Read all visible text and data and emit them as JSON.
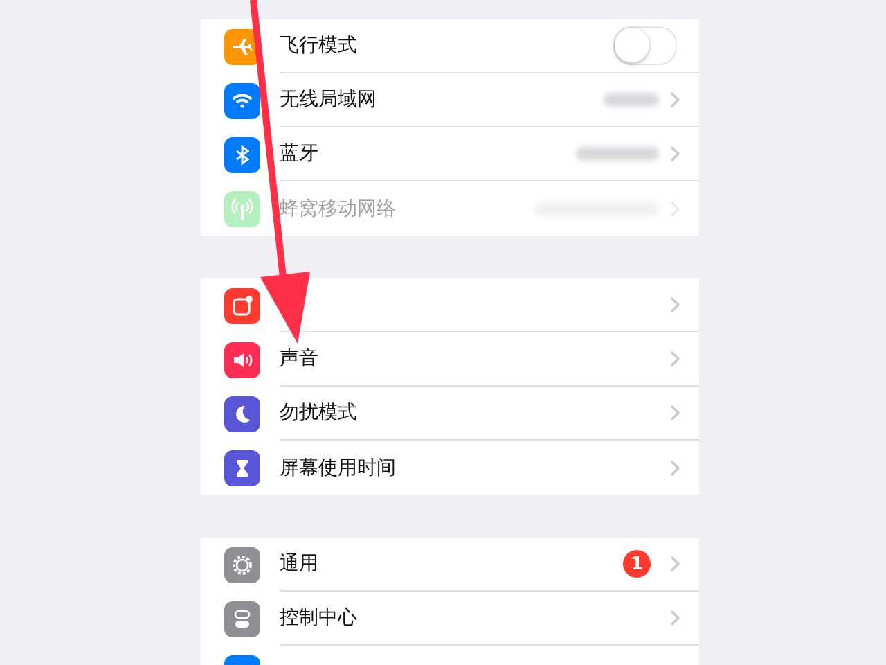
{
  "groups": [
    {
      "items": [
        {
          "kind": "toggle",
          "label": "飞行模式",
          "on": false,
          "disabled": false
        },
        {
          "kind": "hidden-value",
          "label": "无线局域网",
          "disabled": false
        },
        {
          "kind": "hidden-value",
          "label": "蓝牙",
          "disabled": false
        },
        {
          "kind": "hidden-value",
          "label": "蜂窝移动网络",
          "disabled": true
        }
      ]
    },
    {
      "items": [
        {
          "kind": "link",
          "disabled": false
        },
        {
          "kind": "link",
          "label": "声音",
          "disabled": false
        },
        {
          "kind": "link",
          "label": "勿扰模式",
          "disabled": false
        },
        {
          "kind": "link",
          "label": "屏幕使用时间",
          "disabled": false
        }
      ]
    },
    {
      "items": [
        {
          "kind": "badge",
          "label": "通用",
          "badge": "1",
          "disabled": false
        },
        {
          "kind": "link",
          "label": "控制中心",
          "disabled": false
        },
        {
          "kind": "cut",
          "disabled": false
        }
      ]
    }
  ]
}
